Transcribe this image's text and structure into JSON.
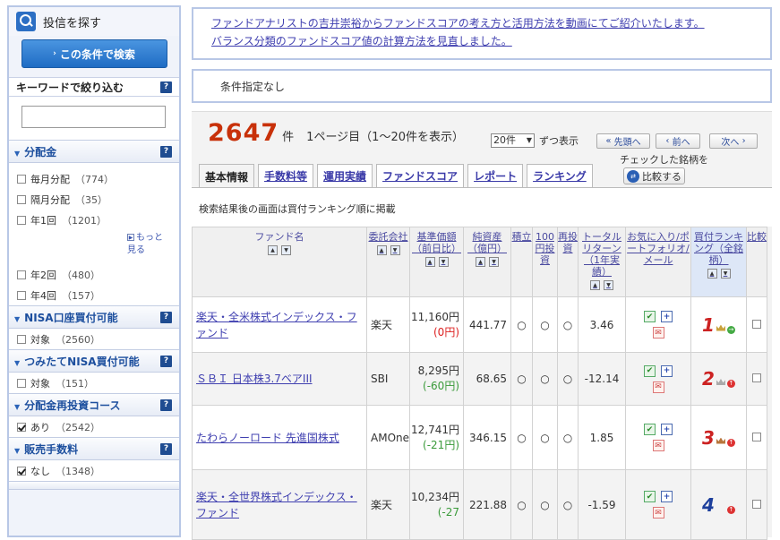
{
  "sidebar": {
    "title": "投信を探す",
    "search_button": "この条件で検索",
    "keyword_heading": "キーワードで絞り込む",
    "keyword_value": "",
    "sections": [
      {
        "heading": "分配金",
        "options": [
          {
            "label": "毎月分配",
            "count": "（774）",
            "checked": false
          },
          {
            "label": "隔月分配",
            "count": "（35）",
            "checked": false
          },
          {
            "label": "年1回",
            "count": "（1201）",
            "checked": false
          }
        ],
        "more_label": "もっと見る",
        "more_options": [
          {
            "label": "年2回",
            "count": "（480）",
            "checked": false
          },
          {
            "label": "年4回",
            "count": "（157）",
            "checked": false
          }
        ]
      },
      {
        "heading": "NISA口座買付可能",
        "options": [
          {
            "label": "対象",
            "count": "（2560）",
            "checked": false
          }
        ]
      },
      {
        "heading": "つみたてNISA買付可能",
        "options": [
          {
            "label": "対象",
            "count": "（151）",
            "checked": false
          }
        ]
      },
      {
        "heading": "分配金再投資コース",
        "options": [
          {
            "label": "あり",
            "count": "（2542）",
            "checked": true
          }
        ]
      },
      {
        "heading": "販売手数料",
        "options": [
          {
            "label": "なし",
            "count": "（1348）",
            "checked": true
          }
        ]
      }
    ],
    "help_icon": "?"
  },
  "notice": {
    "line1": "ファンドアナリストの吉井崇裕からファンドスコアの考え方と活用方法を動画にてご紹介いたします。",
    "line2": "バランス分類のファンドスコア値の計算方法を見直しました。"
  },
  "condition": "条件指定なし",
  "results": {
    "count": "2647",
    "count_unit": "件",
    "page_info": "1ページ目（1～20件を表示）",
    "per_page": "20件",
    "per_page_suffix": "ずつ表示",
    "first_label": "先頭へ",
    "prev_label": "前へ",
    "next_label": "次へ",
    "checked_label": "チェックした銘柄を",
    "compare_label": "比較する",
    "tabs": [
      "基本情報",
      "手数料等",
      "運用実績",
      "ファンドスコア",
      "レポート",
      "ランキング"
    ],
    "active_tab": 0,
    "note": "検索結果後の画面は買付ランキング順に掲載",
    "columns": {
      "name": "ファンド名",
      "company": "委託会社",
      "price": "基準価額（前日比）",
      "assets": "純資産（億円）",
      "tsumitate": "積立",
      "yen100": "100円投資",
      "reinvest": "再投資",
      "return": "トータルリターン（1年実績）",
      "fav": "お気に入り/ポートフォリオ/メール",
      "ranking": "買付ランキング（全銘柄）",
      "compare": "比較"
    },
    "rows": [
      {
        "name": "楽天・全米株式インデックス・ファンド",
        "company": "楽天",
        "price": "11,160円",
        "change": "(0円)",
        "change_color": "red",
        "assets": "441.77",
        "t": "○",
        "y": "○",
        "r": "○",
        "ret": "3.46",
        "rank": "1",
        "trend": "flat"
      },
      {
        "name": "ＳＢＩ 日本株3.7ベアIII",
        "company": "SBI",
        "price": "8,295円",
        "change": "(-60円)",
        "change_color": "green",
        "assets": "68.65",
        "t": "○",
        "y": "○",
        "r": "○",
        "ret": "-12.14",
        "rank": "2",
        "trend": "up"
      },
      {
        "name": "たわらノーロード 先進国株式",
        "company": "AMOne",
        "price": "12,741円",
        "change": "(-21円)",
        "change_color": "green",
        "assets": "346.15",
        "t": "○",
        "y": "○",
        "r": "○",
        "ret": "1.85",
        "rank": "3",
        "trend": "up"
      },
      {
        "name": "楽天・全世界株式インデックス・ファンド",
        "company": "楽天",
        "price": "10,234円",
        "change": "(-27",
        "change_color": "green",
        "assets": "221.88",
        "t": "○",
        "y": "○",
        "r": "○",
        "ret": "-1.59",
        "rank": "4",
        "trend": "up"
      }
    ]
  },
  "colors": {
    "accent": "#c8310a",
    "border": "#b8c7e6",
    "link": "#4040b0"
  }
}
